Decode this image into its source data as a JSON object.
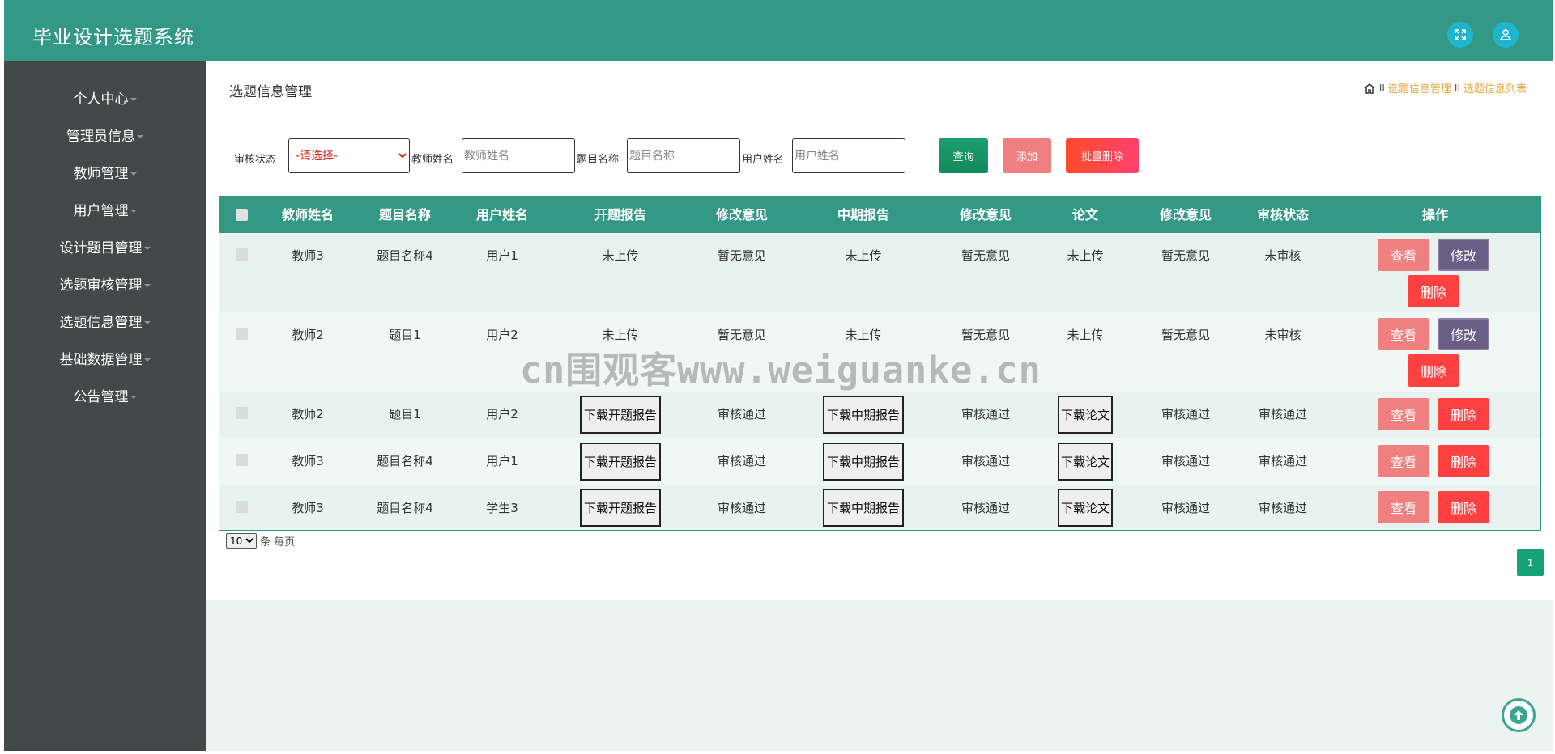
{
  "app": {
    "title": "毕业设计选题系统"
  },
  "header_icons": {
    "fullscreen": "fullscreen-icon",
    "user": "user-icon"
  },
  "sidebar": {
    "items": [
      {
        "label": "个人中心"
      },
      {
        "label": "管理员信息"
      },
      {
        "label": "教师管理"
      },
      {
        "label": "用户管理"
      },
      {
        "label": "设计题目管理"
      },
      {
        "label": "选题审核管理"
      },
      {
        "label": "选题信息管理"
      },
      {
        "label": "基础数据管理"
      },
      {
        "label": "公告管理"
      }
    ]
  },
  "page": {
    "title": "选题信息管理",
    "breadcrumb": {
      "sep": "II",
      "level1": "选题信息管理",
      "level2": "选题信息列表"
    }
  },
  "filters": {
    "status_label": "审核状态",
    "status_value": "-请选择-",
    "teacher_label": "教师姓名",
    "teacher_placeholder": "教师姓名",
    "topic_label": "题目名称",
    "topic_placeholder": "题目名称",
    "user_label": "用户姓名",
    "user_placeholder": "用户姓名",
    "query_button": "查询",
    "add_button": "添加",
    "batch_delete_button": "批量删除"
  },
  "table": {
    "columns": [
      "教师姓名",
      "题目名称",
      "用户姓名",
      "开题报告",
      "修改意见",
      "中期报告",
      "修改意见",
      "论文",
      "修改意见",
      "审核状态",
      "操作"
    ],
    "download_labels": {
      "opening": "下载开题报告",
      "midterm": "下载中期报告",
      "thesis": "下载论文"
    },
    "action_labels": {
      "view": "查看",
      "edit": "修改",
      "delete": "删除"
    },
    "rows": [
      {
        "teacher": "教师3",
        "topic": "题目名称4",
        "user": "用户1",
        "opening": "未上传",
        "opinion1": "暂无意见",
        "midterm": "未上传",
        "opinion2": "暂无意见",
        "thesis": "未上传",
        "opinion3": "暂无意见",
        "status": "未审核"
      },
      {
        "teacher": "教师2",
        "topic": "题目1",
        "user": "用户2",
        "opening": "未上传",
        "opinion1": "暂无意见",
        "midterm": "未上传",
        "opinion2": "暂无意见",
        "thesis": "未上传",
        "opinion3": "暂无意见",
        "status": "未审核"
      },
      {
        "teacher": "教师2",
        "topic": "题目1",
        "user": "用户2",
        "opening": "下载开题报告",
        "opinion1": "审核通过",
        "midterm": "下载中期报告",
        "opinion2": "审核通过",
        "thesis": "下载论文",
        "opinion3": "审核通过",
        "status": "审核通过"
      },
      {
        "teacher": "教师3",
        "topic": "题目名称4",
        "user": "用户1",
        "opening": "下载开题报告",
        "opinion1": "审核通过",
        "midterm": "下载中期报告",
        "opinion2": "审核通过",
        "thesis": "下载论文",
        "opinion3": "审核通过",
        "status": "审核通过"
      },
      {
        "teacher": "教师3",
        "topic": "题目名称4",
        "user": "学生3",
        "opening": "下载开题报告",
        "opinion1": "审核通过",
        "midterm": "下载中期报告",
        "opinion2": "审核通过",
        "thesis": "下载论文",
        "opinion3": "审核通过",
        "status": "审核通过"
      }
    ]
  },
  "pagination": {
    "page_size": "10",
    "page_size_suffix": "条 每页",
    "current_page": "1"
  },
  "watermark": "cn围观客www.weiguanke.cn",
  "colors": {
    "header": "#339886",
    "sidebar": "#414949",
    "accent": "#e8a637",
    "view": "#f08080",
    "edit": "#6b5d86",
    "delete": "#ff4040"
  }
}
